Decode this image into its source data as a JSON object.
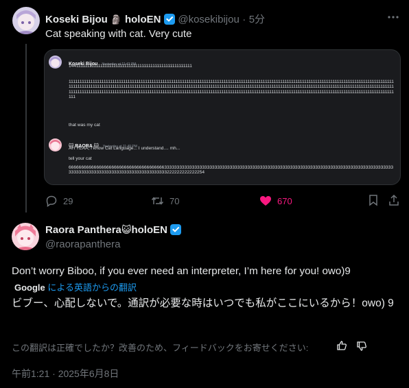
{
  "quoted_post": {
    "author_name": "Koseki Bijou",
    "author_emoji": "🗿",
    "author_suffix": "holoEN",
    "handle": "@kosekibijou",
    "separator": "·",
    "time_ago": "5分",
    "text": "Cat speaking with cat. Very cute",
    "embedded_image": {
      "msg1": {
        "author": "Koseki Bijou",
        "timestamp": "Yesterday at 11:43 PM",
        "line1": "14411111111111111111111111111111111111111111111111111111",
        "block": "111111111111111111111111111111111111111111111111111111111111111111111111111111111111111111111111111111111111111111111111111111111111111111111111111111111111111111111111111111111111111111111111111111111111111111111111111111111111111111111111111111111111111111111111111111111111111111111111111111111111111111111111111111111111111111111111111111111111111111111111111111111111111111111111111111111111111111111111111111111111111111111111111111111111111111",
        "footer": "that was my cat"
      },
      "msg2": {
        "author": "🐱 RAORA 🐱",
        "timestamp": "Yesterday at 11:49 PM",
        "line1": "AH YEAA, I know Cat Language... I understand.... mh...",
        "line2": "tell your cat",
        "line3": "666666666666666666666666666666666666663333333333333333333333333333333333333333333333333333333333333333333333333333333333333333333333333333333333333333333333333333333333222222222222254"
      }
    },
    "actions": {
      "replies": "29",
      "reposts": "70",
      "likes": "670"
    }
  },
  "main_post": {
    "author_name": "Raora Panthera",
    "author_emoji": "😺",
    "author_suffix": "holoEN",
    "handle": "@raorapanthera",
    "text": "Don’t worry Biboo, if you ever need an interpreter, I’m here for you! owo)9",
    "translation": {
      "provider": "Google",
      "label": "による英語からの翻訳",
      "text": "ビブー、心配しないで。通訳が必要な時はいつでも私がここにいるから！owo) 9"
    },
    "feedback_prompt": "この翻訳は正確でしたか？改善のため、フィードバックをお寄せください:",
    "timestamp": "午前1:21 · 2025年6月8日"
  },
  "colors": {
    "background": "#000000",
    "text_primary": "#e7e9ea",
    "text_muted": "#71767b",
    "link_blue": "#1d9bf0",
    "like_pink": "#f91880",
    "verified_blue": "#1d9bf0"
  },
  "icons": [
    "more-icon",
    "verified-icon",
    "reply-icon",
    "repost-icon",
    "like-icon",
    "bookmark-icon",
    "share-icon",
    "thumbs-up-icon",
    "thumbs-down-icon"
  ]
}
